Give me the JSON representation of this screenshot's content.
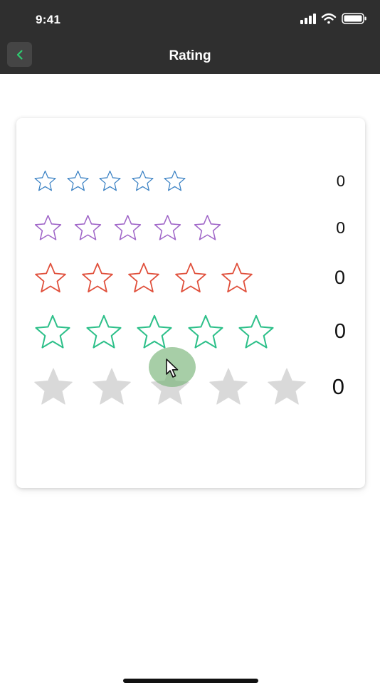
{
  "status_bar": {
    "time": "9:41"
  },
  "nav": {
    "title": "Rating",
    "back_icon": "chevron-left-icon"
  },
  "colors": {
    "bar_bg": "#2f2f2f",
    "back_accent": "#2ecc71",
    "row_colors": [
      "#3b82c4",
      "#a066c8",
      "#e0503c",
      "#2ec08a",
      "#d9d9d9"
    ]
  },
  "ratings": [
    {
      "id": "blue",
      "stars": 5,
      "value": "0",
      "style": "outline"
    },
    {
      "id": "purple",
      "stars": 5,
      "value": "0",
      "style": "outline"
    },
    {
      "id": "red",
      "stars": 5,
      "value": "0",
      "style": "outline"
    },
    {
      "id": "green",
      "stars": 5,
      "value": "0",
      "style": "outline"
    },
    {
      "id": "gray",
      "stars": 5,
      "value": "0",
      "style": "filled"
    }
  ]
}
